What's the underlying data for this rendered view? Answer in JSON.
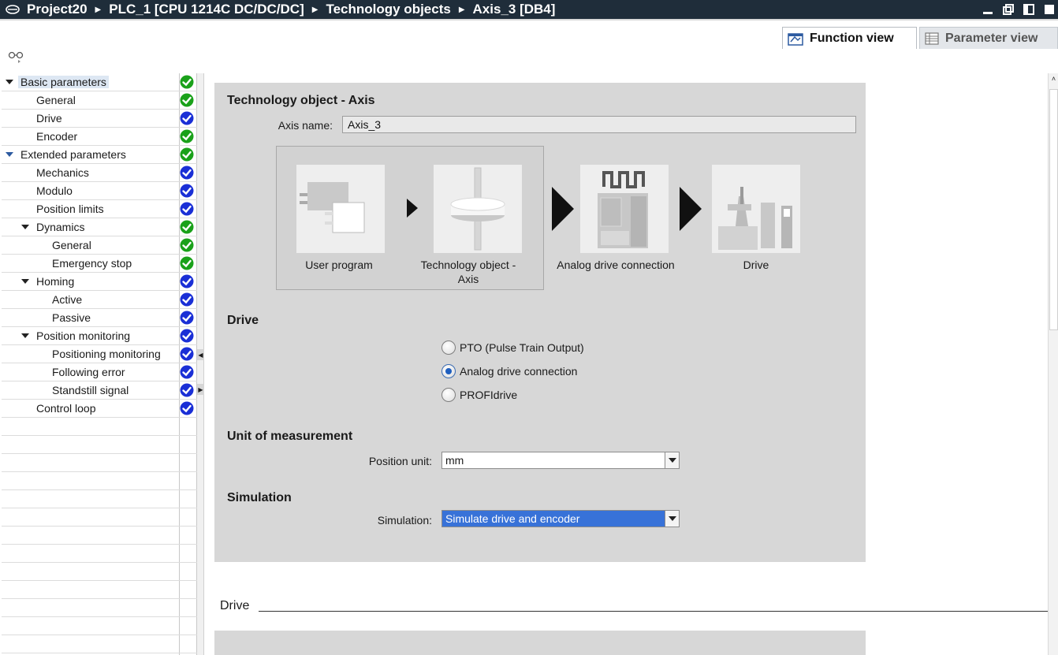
{
  "titlebar": {
    "crumbs": [
      "Project20",
      "PLC_1 [CPU 1214C DC/DC/DC]",
      "Technology objects",
      "Axis_3 [DB4]"
    ]
  },
  "tabs": {
    "function_view": "Function view",
    "parameter_view": "Parameter view",
    "active": "Function view"
  },
  "tree": {
    "items": [
      {
        "label": "Basic parameters",
        "status": "green",
        "expanded": true,
        "selected": true
      },
      {
        "label": "General",
        "status": "green"
      },
      {
        "label": "Drive",
        "status": "blue"
      },
      {
        "label": "Encoder",
        "status": "green"
      },
      {
        "label": "Extended parameters",
        "status": "green",
        "expanded": true
      },
      {
        "label": "Mechanics",
        "status": "blue"
      },
      {
        "label": "Modulo",
        "status": "blue"
      },
      {
        "label": "Position limits",
        "status": "blue"
      },
      {
        "label": "Dynamics",
        "status": "green",
        "expanded": true
      },
      {
        "label": "General",
        "status": "green"
      },
      {
        "label": "Emergency stop",
        "status": "green"
      },
      {
        "label": "Homing",
        "status": "blue",
        "expanded": true
      },
      {
        "label": "Active",
        "status": "blue"
      },
      {
        "label": "Passive",
        "status": "blue"
      },
      {
        "label": "Position monitoring",
        "status": "blue",
        "expanded": true
      },
      {
        "label": "Positioning monitoring",
        "status": "blue"
      },
      {
        "label": "Following error",
        "status": "blue"
      },
      {
        "label": "Standstill signal",
        "status": "blue"
      },
      {
        "label": "Control loop",
        "status": "blue"
      }
    ]
  },
  "panel": {
    "title": "Technology object - Axis",
    "axis_name_label": "Axis name:",
    "axis_name_value": "Axis_3",
    "diagram": {
      "user_program": "User program",
      "technology_object_line1": "Technology object -",
      "technology_object_line2": "Axis",
      "analog_drive_connection": "Analog drive connection",
      "drive": "Drive"
    },
    "drive_section": {
      "title": "Drive",
      "options": [
        {
          "label": "PTO (Pulse Train Output)",
          "checked": false
        },
        {
          "label": "Analog drive connection",
          "checked": true
        },
        {
          "label": "PROFIdrive",
          "checked": false
        }
      ]
    },
    "unit_section": {
      "title": "Unit of measurement",
      "position_unit_label": "Position unit:",
      "position_unit_value": "mm"
    },
    "simulation_section": {
      "title": "Simulation",
      "simulation_label": "Simulation:",
      "simulation_value": "Simulate drive and encoder"
    }
  },
  "below": {
    "heading": "Drive"
  },
  "colors": {
    "status_green": "#1aa11a",
    "status_blue": "#1a2fd6",
    "titlebar": "#1f2d3a",
    "panel": "#d7d7d7",
    "selection": "#3872d8"
  }
}
